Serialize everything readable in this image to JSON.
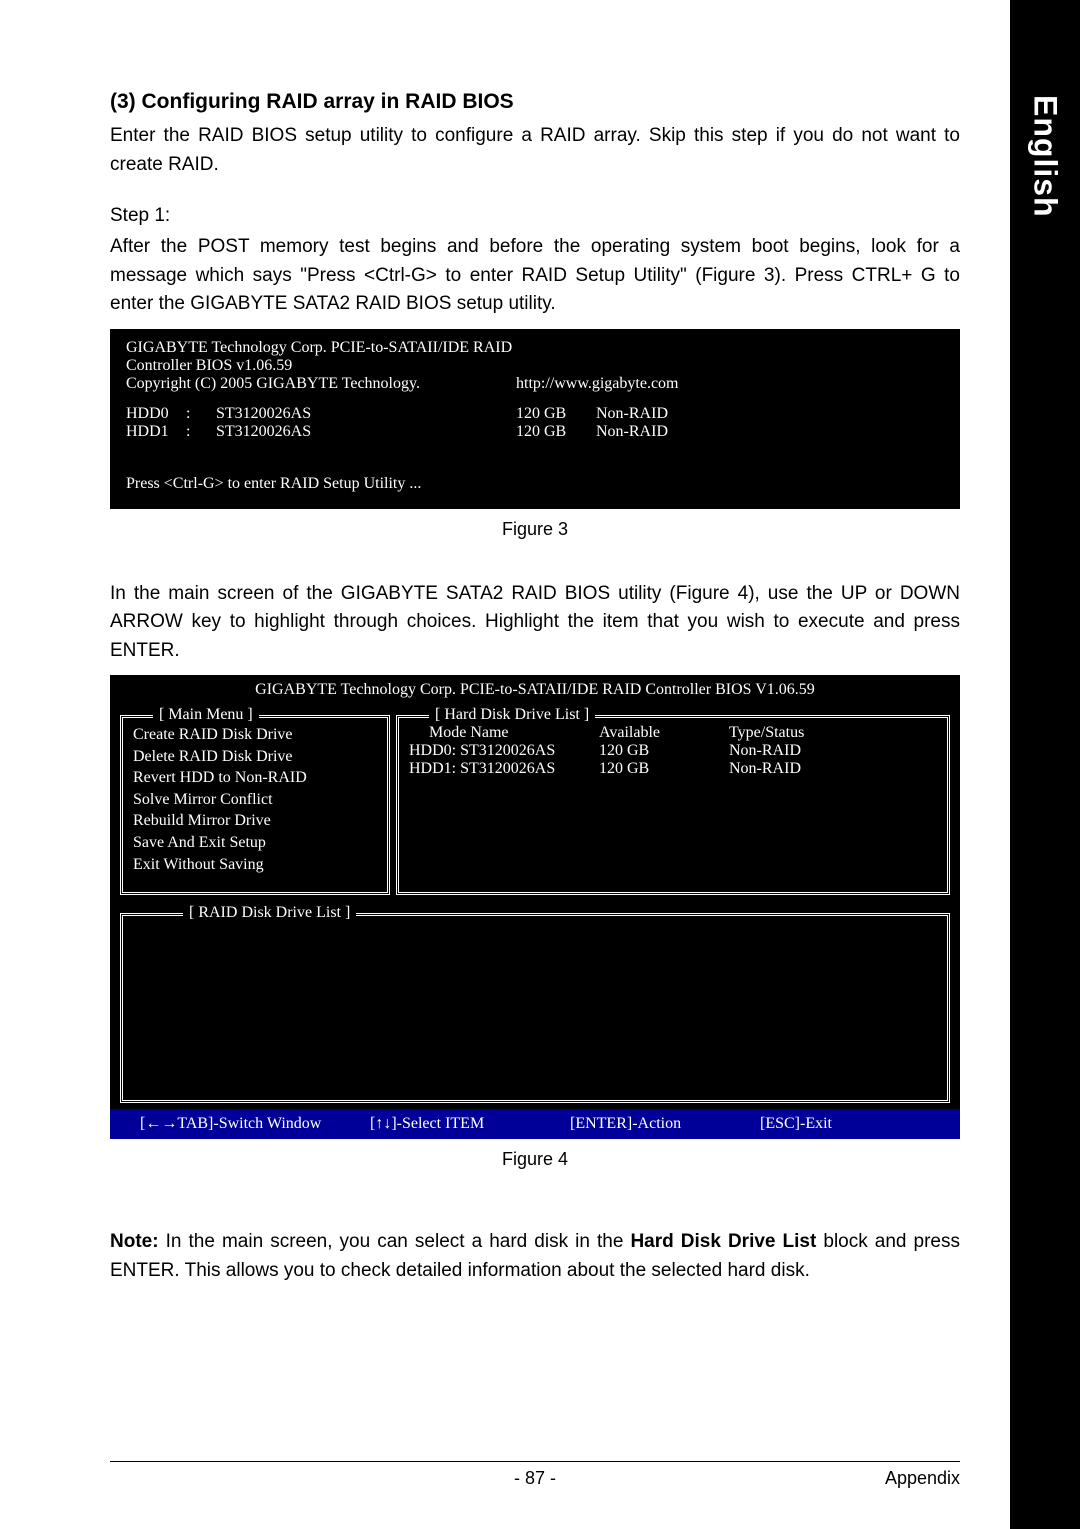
{
  "sideTab": "English",
  "section": {
    "title": "(3) Configuring RAID array in RAID BIOS",
    "intro": "Enter the RAID BIOS setup utility to configure a RAID array. Skip this step if you do not want to create RAID.",
    "stepLabel": "Step 1:",
    "stepText": "After the POST memory test begins and before the operating system boot begins, look for a message which says \"Press <Ctrl-G> to enter RAID Setup Utility\" (Figure 3). Press CTRL+ G to enter the GIGABYTE SATA2 RAID BIOS setup utility."
  },
  "figure3": {
    "header1": "GIGABYTE Technology Corp. PCIE-to-SATAII/IDE RAID Controller BIOS v1.06.59",
    "header2": "Copyright (C) 2005 GIGABYTE Technology.",
    "url": "http://www.gigabyte.com",
    "drives": [
      {
        "slot": "HDD0",
        "colon": ":",
        "model": "ST3120026AS",
        "size": "120 GB",
        "status": "Non-RAID"
      },
      {
        "slot": "HDD1",
        "colon": ":",
        "model": "ST3120026AS",
        "size": "120 GB",
        "status": "Non-RAID"
      }
    ],
    "prompt": "Press <Ctrl-G> to enter RAID Setup Utility ...",
    "caption": "Figure 3"
  },
  "middleText": "In the main screen of the GIGABYTE SATA2 RAID BIOS utility (Figure 4), use the UP or DOWN ARROW key to highlight through choices. Highlight the item that you wish to execute and press ENTER.",
  "figure4": {
    "header": "GIGABYTE Technology Corp. PCIE-to-SATAII/IDE RAID Controller BIOS V1.06.59",
    "mainMenuLabel": "[ Main Menu ]",
    "menuItems": [
      "Create RAID Disk Drive",
      "Delete RAID Disk Drive",
      "Revert HDD to Non-RAID",
      "Solve Mirror Conflict",
      "Rebuild Mirror Drive",
      "Save And Exit Setup",
      "Exit Without Saving"
    ],
    "hddListLabel": "[ Hard Disk Drive List ]",
    "hddHeader": {
      "c1": "Mode Name",
      "c2": "Available",
      "c3": "Type/Status"
    },
    "hddRows": [
      {
        "c1": "HDD0:  ST3120026AS",
        "c2": "120 GB",
        "c3": "Non-RAID"
      },
      {
        "c1": "HDD1:  ST3120026AS",
        "c2": "120 GB",
        "c3": "Non-RAID"
      }
    ],
    "raidListLabel": "[ RAID Disk Drive List ]",
    "footer": {
      "f1": "[←→TAB]-Switch Window",
      "f2": "[↑↓]-Select ITEM",
      "f3": "[ENTER]-Action",
      "f4": "[ESC]-Exit"
    },
    "caption": "Figure 4"
  },
  "note": {
    "label": "Note:",
    "text1": " In the main screen, you can select a hard disk in the ",
    "bold": "Hard Disk Drive List",
    "text2": " block and press ENTER. This allows you to check detailed information about the selected hard disk."
  },
  "footer": {
    "page": "- 87 -",
    "section": "Appendix"
  }
}
